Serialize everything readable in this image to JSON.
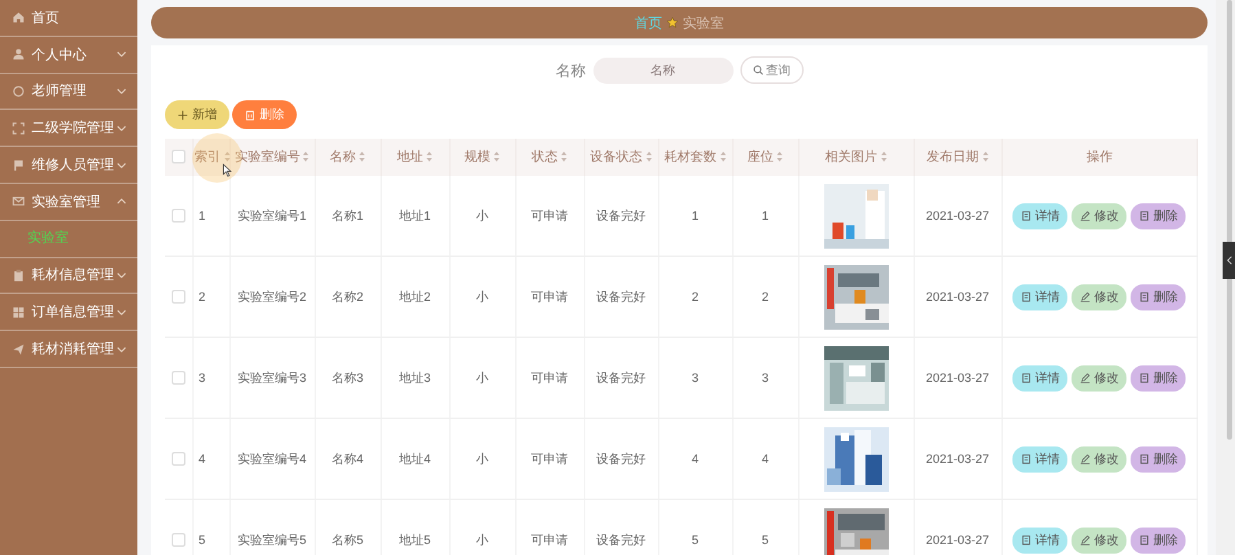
{
  "sidebar": {
    "items": [
      {
        "label": "首页",
        "kind": "link"
      },
      {
        "label": "个人中心",
        "kind": "menu",
        "expanded": false
      },
      {
        "label": "老师管理",
        "kind": "menu",
        "expanded": false
      },
      {
        "label": "二级学院管理",
        "kind": "menu",
        "expanded": false
      },
      {
        "label": "维修人员管理",
        "kind": "menu",
        "expanded": false
      },
      {
        "label": "实验室管理",
        "kind": "menu",
        "expanded": true,
        "children": [
          {
            "label": "实验室",
            "selected": true
          }
        ]
      },
      {
        "label": "耗材信息管理",
        "kind": "menu",
        "expanded": false
      },
      {
        "label": "订单信息管理",
        "kind": "menu",
        "expanded": false
      },
      {
        "label": "耗材消耗管理",
        "kind": "menu",
        "expanded": false
      }
    ]
  },
  "breadcrumb": {
    "home": "首页",
    "current": "实验室"
  },
  "search": {
    "label": "名称",
    "placeholder": "名称",
    "button": "查询"
  },
  "toolbar": {
    "add": "新增",
    "delete": "删除"
  },
  "table": {
    "select_all": false,
    "columns": [
      "索引",
      "实验室编号",
      "名称",
      "地址",
      "规模",
      "状态",
      "设备状态",
      "耗材套数",
      "座位",
      "相关图片",
      "发布日期",
      "操作"
    ],
    "rows": [
      {
        "checked": false,
        "cells": [
          "1",
          "实验室编号1",
          "名称1",
          "地址1",
          "小",
          "可申请",
          "设备完好",
          "1",
          "1"
        ],
        "date": "2021-03-27",
        "actions": [
          {
            "kind": "detail",
            "label": "详情"
          },
          {
            "kind": "edit",
            "label": "修改"
          },
          {
            "kind": "delete",
            "label": "删除"
          }
        ]
      },
      {
        "checked": false,
        "cells": [
          "2",
          "实验室编号2",
          "名称2",
          "地址2",
          "小",
          "可申请",
          "设备完好",
          "2",
          "2"
        ],
        "date": "2021-03-27",
        "actions": [
          {
            "kind": "detail",
            "label": "详情"
          },
          {
            "kind": "edit",
            "label": "修改"
          },
          {
            "kind": "delete",
            "label": "删除"
          }
        ]
      },
      {
        "checked": false,
        "cells": [
          "3",
          "实验室编号3",
          "名称3",
          "地址3",
          "小",
          "可申请",
          "设备完好",
          "3",
          "3"
        ],
        "date": "2021-03-27",
        "actions": [
          {
            "kind": "detail",
            "label": "详情"
          },
          {
            "kind": "edit",
            "label": "修改"
          },
          {
            "kind": "delete",
            "label": "删除"
          }
        ]
      },
      {
        "checked": false,
        "cells": [
          "4",
          "实验室编号4",
          "名称4",
          "地址4",
          "小",
          "可申请",
          "设备完好",
          "4",
          "4"
        ],
        "date": "2021-03-27",
        "actions": [
          {
            "kind": "detail",
            "label": "详情"
          },
          {
            "kind": "edit",
            "label": "修改"
          },
          {
            "kind": "delete",
            "label": "删除"
          }
        ]
      },
      {
        "checked": false,
        "cells": [
          "5",
          "实验室编号5",
          "名称5",
          "地址5",
          "小",
          "可申请",
          "设备完好",
          "5",
          "5"
        ],
        "date": "2021-03-27",
        "actions": [
          {
            "kind": "detail",
            "label": "详情"
          },
          {
            "kind": "edit",
            "label": "修改"
          },
          {
            "kind": "delete",
            "label": "删除"
          }
        ]
      }
    ]
  }
}
